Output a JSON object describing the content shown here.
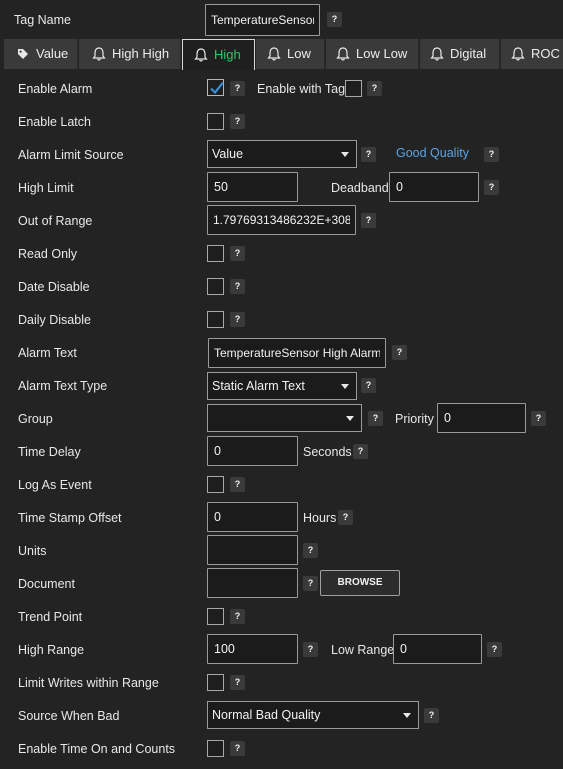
{
  "tag_name": {
    "label": "Tag Name",
    "value": "TemperatureSensor"
  },
  "help_glyph": "?",
  "tabs": [
    {
      "label": "Value",
      "icon": "tag-icon"
    },
    {
      "label": "High High",
      "icon": "bell-icon"
    },
    {
      "label": "High",
      "icon": "bell-icon",
      "active": true
    },
    {
      "label": "Low",
      "icon": "bell-icon"
    },
    {
      "label": "Low Low",
      "icon": "bell-icon"
    },
    {
      "label": "Digital",
      "icon": "bell-icon"
    },
    {
      "label": "ROC",
      "icon": "bell-icon"
    }
  ],
  "colors": {
    "active_tab": "#38c26b",
    "link": "#5aa4e6",
    "check": "#3a8fd8"
  },
  "fields": {
    "enable_alarm": {
      "label": "Enable Alarm",
      "checked": true,
      "extra_label": "Enable with Tag",
      "extra_checked": false
    },
    "enable_latch": {
      "label": "Enable Latch",
      "checked": false
    },
    "alarm_limit_source": {
      "label": "Alarm Limit Source",
      "value": "Value",
      "status": "Good Quality"
    },
    "high_limit": {
      "label": "High Limit",
      "value": "50",
      "deadband_label": "Deadband",
      "deadband_value": "0"
    },
    "out_of_range": {
      "label": "Out of Range",
      "value": "1.79769313486232E+308"
    },
    "read_only": {
      "label": "Read Only",
      "checked": false
    },
    "date_disable": {
      "label": "Date Disable",
      "checked": false
    },
    "daily_disable": {
      "label": "Daily Disable",
      "checked": false
    },
    "alarm_text": {
      "label": "Alarm Text",
      "value": "TemperatureSensor High Alarm"
    },
    "alarm_text_type": {
      "label": "Alarm Text Type",
      "value": "Static Alarm Text"
    },
    "group": {
      "label": "Group",
      "value": "",
      "priority_label": "Priority",
      "priority_value": "0"
    },
    "time_delay": {
      "label": "Time Delay",
      "value": "0",
      "unit": "Seconds"
    },
    "log_as_event": {
      "label": "Log As Event",
      "checked": false
    },
    "time_stamp_offset": {
      "label": "Time Stamp Offset",
      "value": "0",
      "unit": "Hours"
    },
    "units": {
      "label": "Units",
      "value": ""
    },
    "document": {
      "label": "Document",
      "value": "",
      "browse_label": "BROWSE"
    },
    "trend_point": {
      "label": "Trend Point",
      "checked": false
    },
    "high_range": {
      "label": "High Range",
      "value": "100",
      "low_label": "Low Range",
      "low_value": "0"
    },
    "limit_writes": {
      "label": "Limit Writes within Range",
      "checked": false
    },
    "source_when_bad": {
      "label": "Source When Bad",
      "value": "Normal Bad Quality"
    },
    "enable_time_on": {
      "label": "Enable Time On and Counts",
      "checked": false
    }
  }
}
